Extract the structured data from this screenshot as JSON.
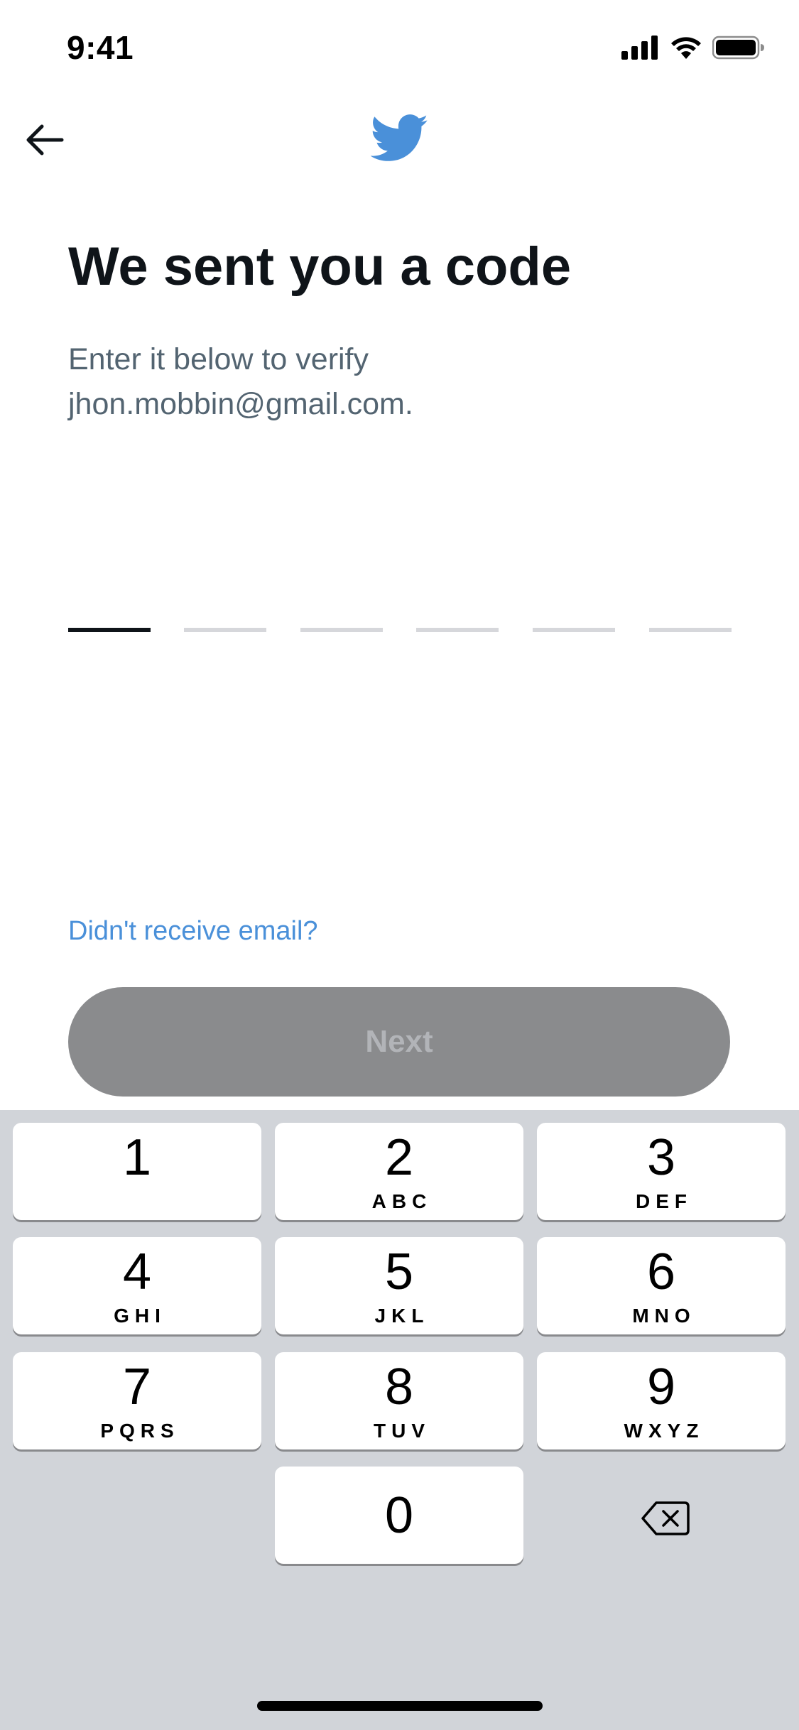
{
  "status_bar": {
    "time": "9:41"
  },
  "icons": {
    "back": "arrow-left-icon",
    "logo": "twitter-bird-icon",
    "signal": "cellular-signal-icon",
    "wifi": "wifi-icon",
    "battery": "battery-icon",
    "delete": "backspace-icon"
  },
  "colors": {
    "brand": "#4a90d9",
    "title": "#0f1419",
    "subtitle": "#536471",
    "button_disabled": "#8a8b8d",
    "keyboard_bg": "#d1d4d9"
  },
  "content": {
    "title": "We sent you a code",
    "subtitle_line1": "Enter it below to verify",
    "subtitle_line2": "jhon.mobbin@gmail.com.",
    "code_length": 6,
    "active_slot": 1,
    "resend_link": "Didn't receive email?",
    "next_label": "Next"
  },
  "keyboard": {
    "keys": [
      {
        "num": "1",
        "letters": ""
      },
      {
        "num": "2",
        "letters": "ABC"
      },
      {
        "num": "3",
        "letters": "DEF"
      },
      {
        "num": "4",
        "letters": "GHI"
      },
      {
        "num": "5",
        "letters": "JKL"
      },
      {
        "num": "6",
        "letters": "MNO"
      },
      {
        "num": "7",
        "letters": "PQRS"
      },
      {
        "num": "8",
        "letters": "TUV"
      },
      {
        "num": "9",
        "letters": "WXYZ"
      },
      {
        "num": "0",
        "letters": ""
      }
    ]
  }
}
